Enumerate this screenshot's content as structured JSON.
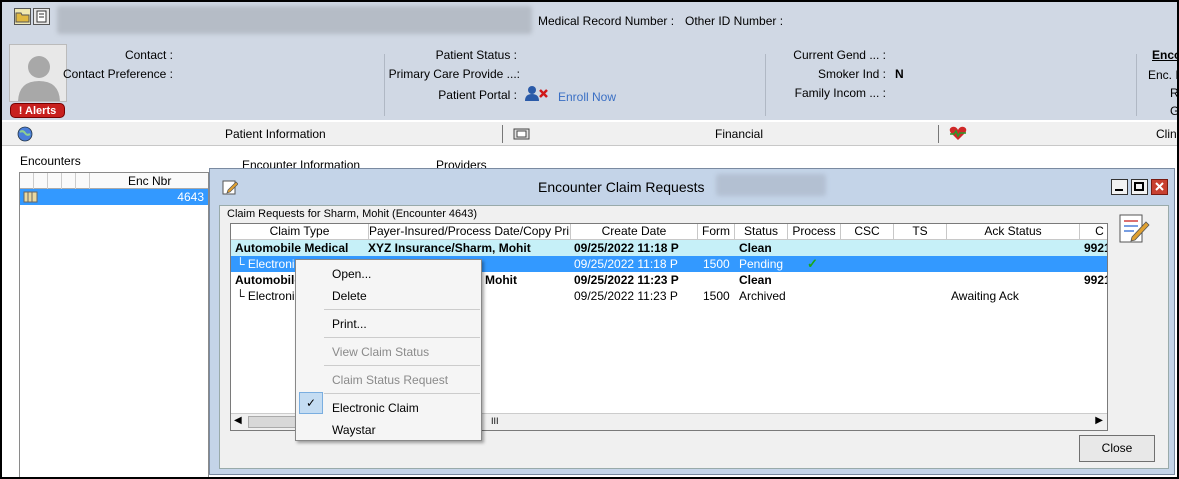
{
  "header": {
    "medical_record_label": "Medical Record Number :",
    "other_id_label": "Other ID Number :",
    "contact_label": "Contact :",
    "contact_pref_label": "Contact Preference :",
    "patient_status_label": "Patient Status :",
    "primary_care_label": "Primary Care Provide ...:",
    "patient_portal_label": "Patient Portal :",
    "enroll_now": "Enroll Now",
    "current_gender_label": "Current Gend ... :",
    "smoker_label": "Smoker Ind :",
    "smoker_value": "N",
    "family_income_label": "Family Incom ... :",
    "enc_heading": "Enco",
    "enc_line1": "Enc. I",
    "enc_line2": "R",
    "enc_line3": "G",
    "alerts": "! Alerts"
  },
  "tabs": [
    {
      "label": "Patient Information"
    },
    {
      "label": "Financial"
    },
    {
      "label": "Clin"
    }
  ],
  "left_panel": {
    "encounters_label": "Encounters",
    "encounter_info_tab": "Encounter Information",
    "providers_tab": "Providers",
    "col_enc_nbr": "Enc Nbr",
    "rows": [
      {
        "enc_nbr": "4643"
      }
    ]
  },
  "dialog": {
    "title": "Encounter Claim Requests",
    "subtitle": "Claim Requests for Sharm, Mohit (Encounter 4643)",
    "columns": [
      "Claim Type",
      "Payer-Insured/Process Date/Copy Print",
      "Create Date",
      "Form",
      "Status",
      "Process",
      "CSC",
      "TS",
      "Ack Status",
      "C"
    ],
    "rows": [
      {
        "claim_type": "Automobile Medical",
        "payer": "XYZ Insurance/Sharm, Mohit",
        "create_date": "09/25/2022 11:18 P",
        "form": "",
        "status": "Clean",
        "process": "",
        "ack": "",
        "c": "9921"
      },
      {
        "claim_type": "Electronic",
        "payer": "",
        "create_date": "09/25/2022 11:18 P",
        "form": "1500",
        "status": "Pending",
        "process": "✓",
        "ack": "",
        "c": ""
      },
      {
        "claim_type": "Automobile",
        "payer": "Mohit",
        "create_date": "09/25/2022 11:23 P",
        "form": "",
        "status": "Clean",
        "process": "",
        "ack": "",
        "c": "9921"
      },
      {
        "claim_type": "Electronic",
        "payer": "",
        "create_date": "09/25/2022 11:23 P",
        "form": "1500",
        "status": "Archived",
        "process": "",
        "ack": "Awaiting Ack",
        "c": ""
      }
    ],
    "scroll_glyph": "III",
    "close_button": "Close"
  },
  "context_menu": {
    "open": "Open...",
    "delete": "Delete",
    "print": "Print...",
    "view_claim_status": "View Claim Status",
    "claim_status_request": "Claim Status Request",
    "electronic_claim": "Electronic Claim",
    "waystar": "Waystar",
    "check": "✓"
  },
  "colors": {
    "header_bg": "#d0d8e4",
    "selection": "#3399ff",
    "row_highlight": "#c6f0f8",
    "alert_red": "#c8201e",
    "link_blue": "#3a6fc4"
  }
}
